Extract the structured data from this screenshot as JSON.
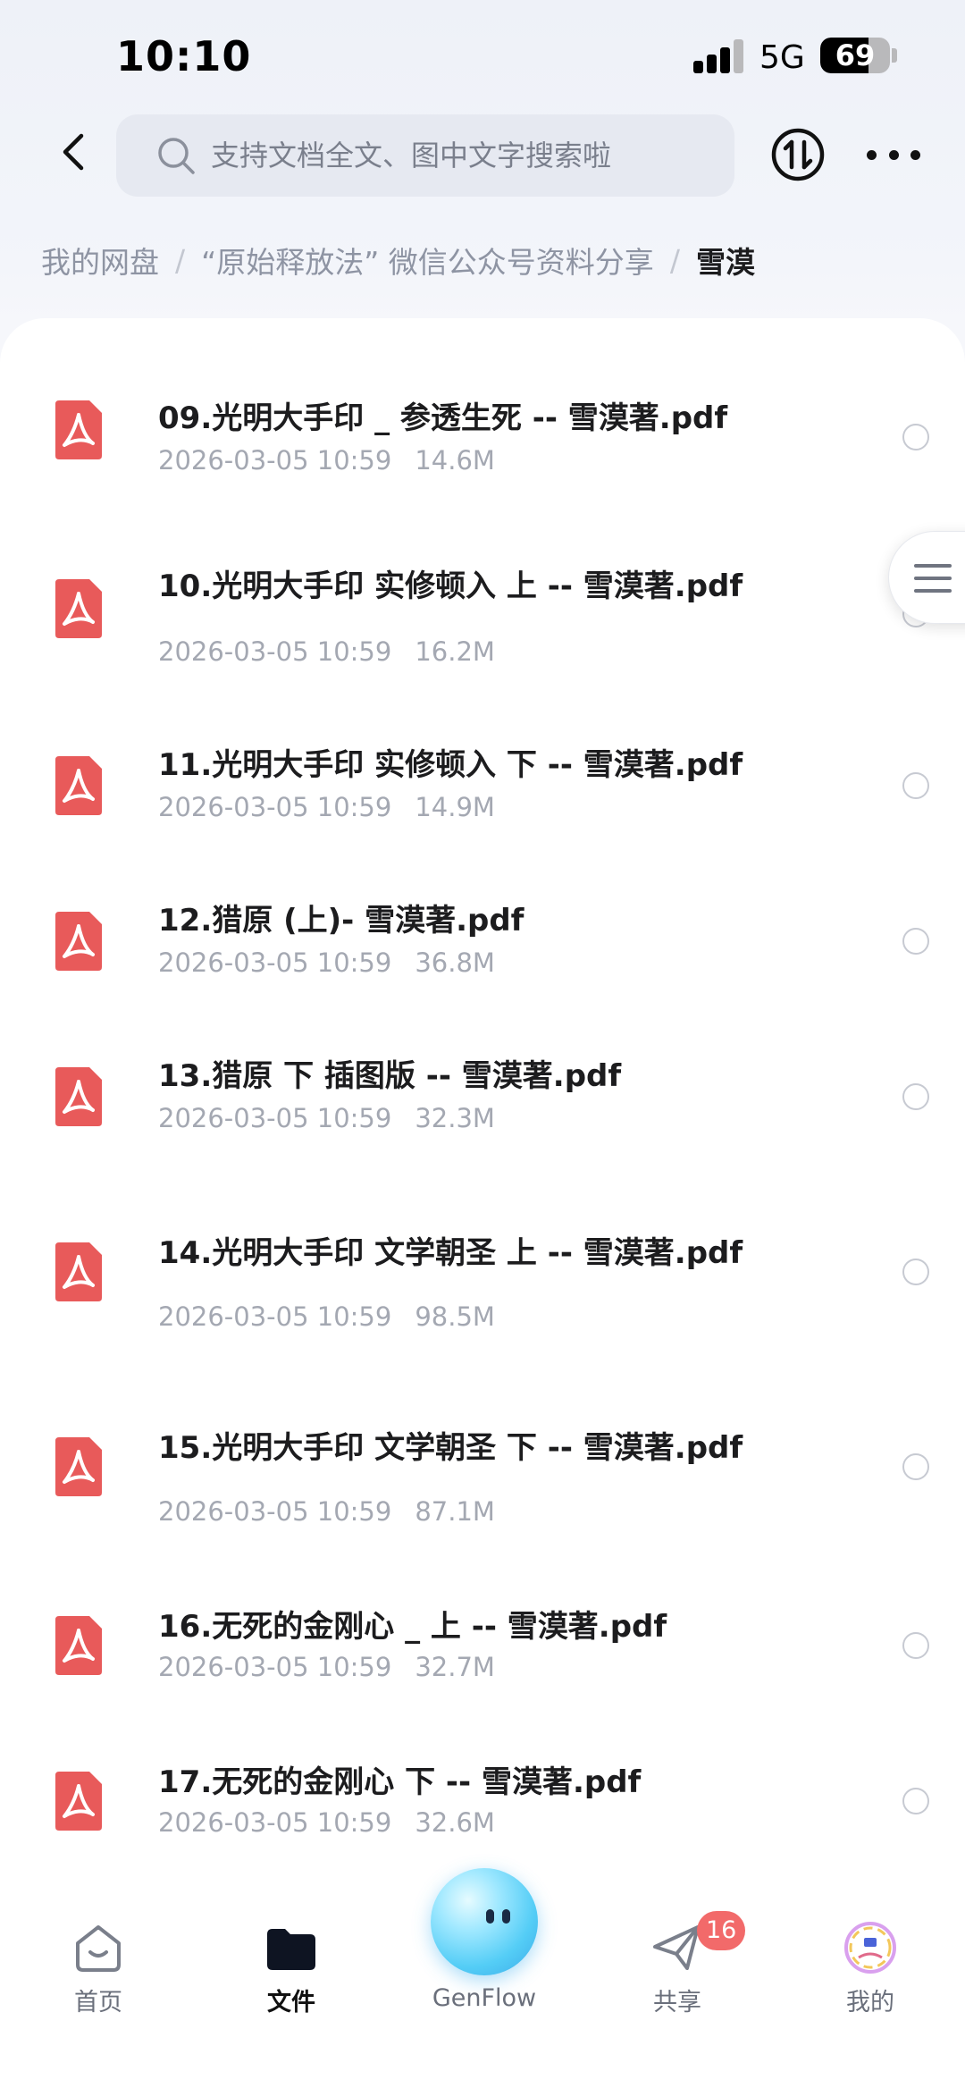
{
  "status_bar": {
    "time": "10:10",
    "network": "5G",
    "battery_percent": "69",
    "battery_level": 0.69
  },
  "header": {
    "search_placeholder": "支持文档全文、图中文字搜索啦",
    "icons": [
      "chevron-left-icon",
      "search-icon",
      "transfer-icon",
      "more-icon"
    ]
  },
  "breadcrumb": {
    "items": [
      "我的网盘",
      "“原始释放法” 微信公众号资料分享"
    ],
    "separator": "/",
    "current": "雪漠"
  },
  "files": [
    {
      "name": "09.光明大手印 _ 参透生死 -- 雪漠著.pdf",
      "date": "2026-03-05 10:59",
      "size": "14.6M"
    },
    {
      "name": "10.光明大手印  实修顿入  上 -- 雪漠著.pdf",
      "date": "2026-03-05 10:59",
      "size": "16.2M"
    },
    {
      "name": "11.光明大手印 实修顿入 下 -- 雪漠著.pdf",
      "date": "2026-03-05 10:59",
      "size": "14.9M"
    },
    {
      "name": "12.猎原 (上)- 雪漠著.pdf",
      "date": "2026-03-05 10:59",
      "size": "36.8M"
    },
    {
      "name": "13.猎原  下  插图版 -- 雪漠著.pdf",
      "date": "2026-03-05 10:59",
      "size": "32.3M"
    },
    {
      "name": "14.光明大手印  文学朝圣  上 -- 雪漠著.pdf",
      "date": "2026-03-05 10:59",
      "size": "98.5M"
    },
    {
      "name": "15.光明大手印  文学朝圣  下 -- 雪漠著.pdf",
      "date": "2026-03-05 10:59",
      "size": "87.1M"
    },
    {
      "name": "16.无死的金刚心 _ 上 -- 雪漠著.pdf",
      "date": "2026-03-05 10:59",
      "size": "32.7M"
    },
    {
      "name": "17.无死的金刚心  下 -- 雪漠著.pdf",
      "date": "2026-03-05 10:59",
      "size": "32.6M"
    }
  ],
  "tab_bar": {
    "tabs": [
      {
        "label": "首页",
        "icon": "home-icon"
      },
      {
        "label": "文件",
        "icon": "folder-icon",
        "active": true
      },
      {
        "label": "GenFlow",
        "icon": "genflow-orb-icon"
      },
      {
        "label": "共享",
        "icon": "paper-plane-icon",
        "badge": "16"
      },
      {
        "label": "我的",
        "icon": "avatar-icon"
      }
    ]
  },
  "colors": {
    "pdf_icon": "#e85a5a",
    "badge": "#f26a6a",
    "accent_orb": "#54cdf6",
    "text_primary": "#1c1c1e",
    "text_secondary": "#a4a8b2"
  }
}
